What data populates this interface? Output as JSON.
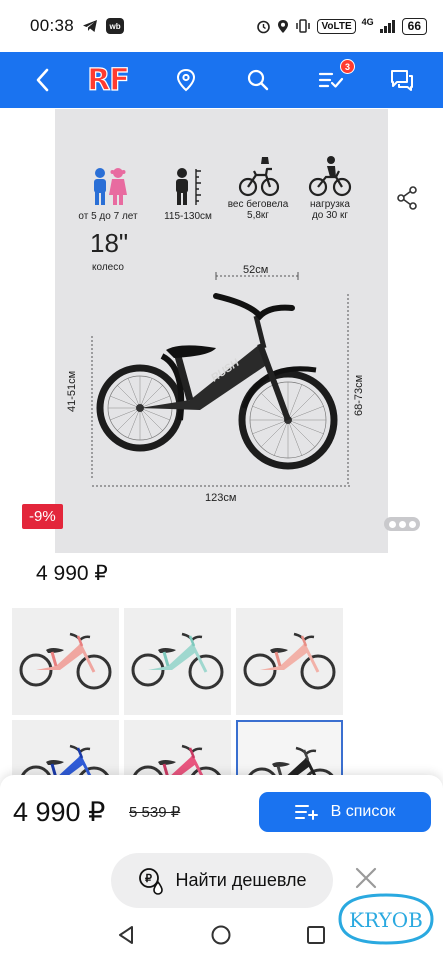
{
  "status_bar": {
    "time": "00:38",
    "network": "4G",
    "volte": "VoLTE",
    "battery": "66"
  },
  "app_bar": {
    "logo_text": "RF",
    "cart_count": "3",
    "icons": [
      "back-arrow-icon",
      "location-icon",
      "search-icon",
      "cart-list-icon",
      "chat-icon"
    ]
  },
  "product_image": {
    "specs": [
      {
        "icon": "kids-icon",
        "label": "от 5 до 7 лет"
      },
      {
        "icon": "height-icon",
        "label": "115-130см"
      },
      {
        "icon": "weight-icon",
        "label": "вес беговела\n5,8кг"
      },
      {
        "icon": "load-icon",
        "label": "нагрузка\nдо 30 кг"
      }
    ],
    "wheel_size": "18\"",
    "wheel_label": "колесо",
    "dimensions": {
      "top": "52см",
      "left": "41-51см",
      "right": "68-73см",
      "bottom": "123см"
    },
    "frame_text": "RUSH"
  },
  "discount_badge": "-9%",
  "price": "4 990 ₽",
  "thumbnails": [
    {
      "color": "#f0a6a0",
      "accent": "#e87f7f"
    },
    {
      "color": "#9fd8cf",
      "accent": "#7ec9bd"
    },
    {
      "color": "#f2b1a8",
      "accent": "#e88f86"
    },
    {
      "color": "#2f5bd6",
      "accent": "#1a3aa8"
    },
    {
      "color": "#e8557e",
      "accent": "#c93a63"
    },
    {
      "color": "#222222",
      "accent": "#444444"
    }
  ],
  "bottom_panel": {
    "price": "4 990 ₽",
    "old_price": "5 539 ₽",
    "add_to_list_label": "В список",
    "find_cheaper_label": "Найти дешевле"
  },
  "watermark_text": "KRYOB",
  "colors": {
    "primary": "#1a73f0",
    "discount": "#e3263b",
    "logo": "#ff3b30"
  }
}
